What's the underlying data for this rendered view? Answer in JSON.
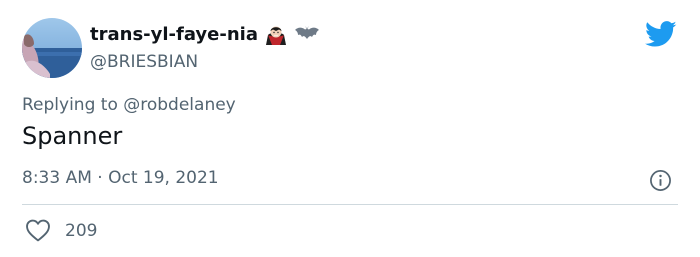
{
  "author": {
    "display_name": "trans-yl-faye-nia",
    "handle": "@BRIESBIAN",
    "name_emojis": [
      "vampire-emoji",
      "bat-emoji"
    ],
    "avatar": "profile-photo"
  },
  "reply": {
    "prefix": "Replying to",
    "mention": "@robdelaney"
  },
  "tweet": {
    "text": "Spanner",
    "time": "8:33 AM",
    "separator": "·",
    "date": "Oct 19, 2021"
  },
  "engagement": {
    "like_icon": "heart-icon",
    "like_count": "209"
  },
  "icons": {
    "brand": "twitter-bird-icon",
    "info": "info-icon"
  },
  "colors": {
    "twitter_blue": "#1d9bf0",
    "secondary_text": "#536471",
    "primary_text": "#0f1419",
    "divider": "#cfd9de"
  }
}
